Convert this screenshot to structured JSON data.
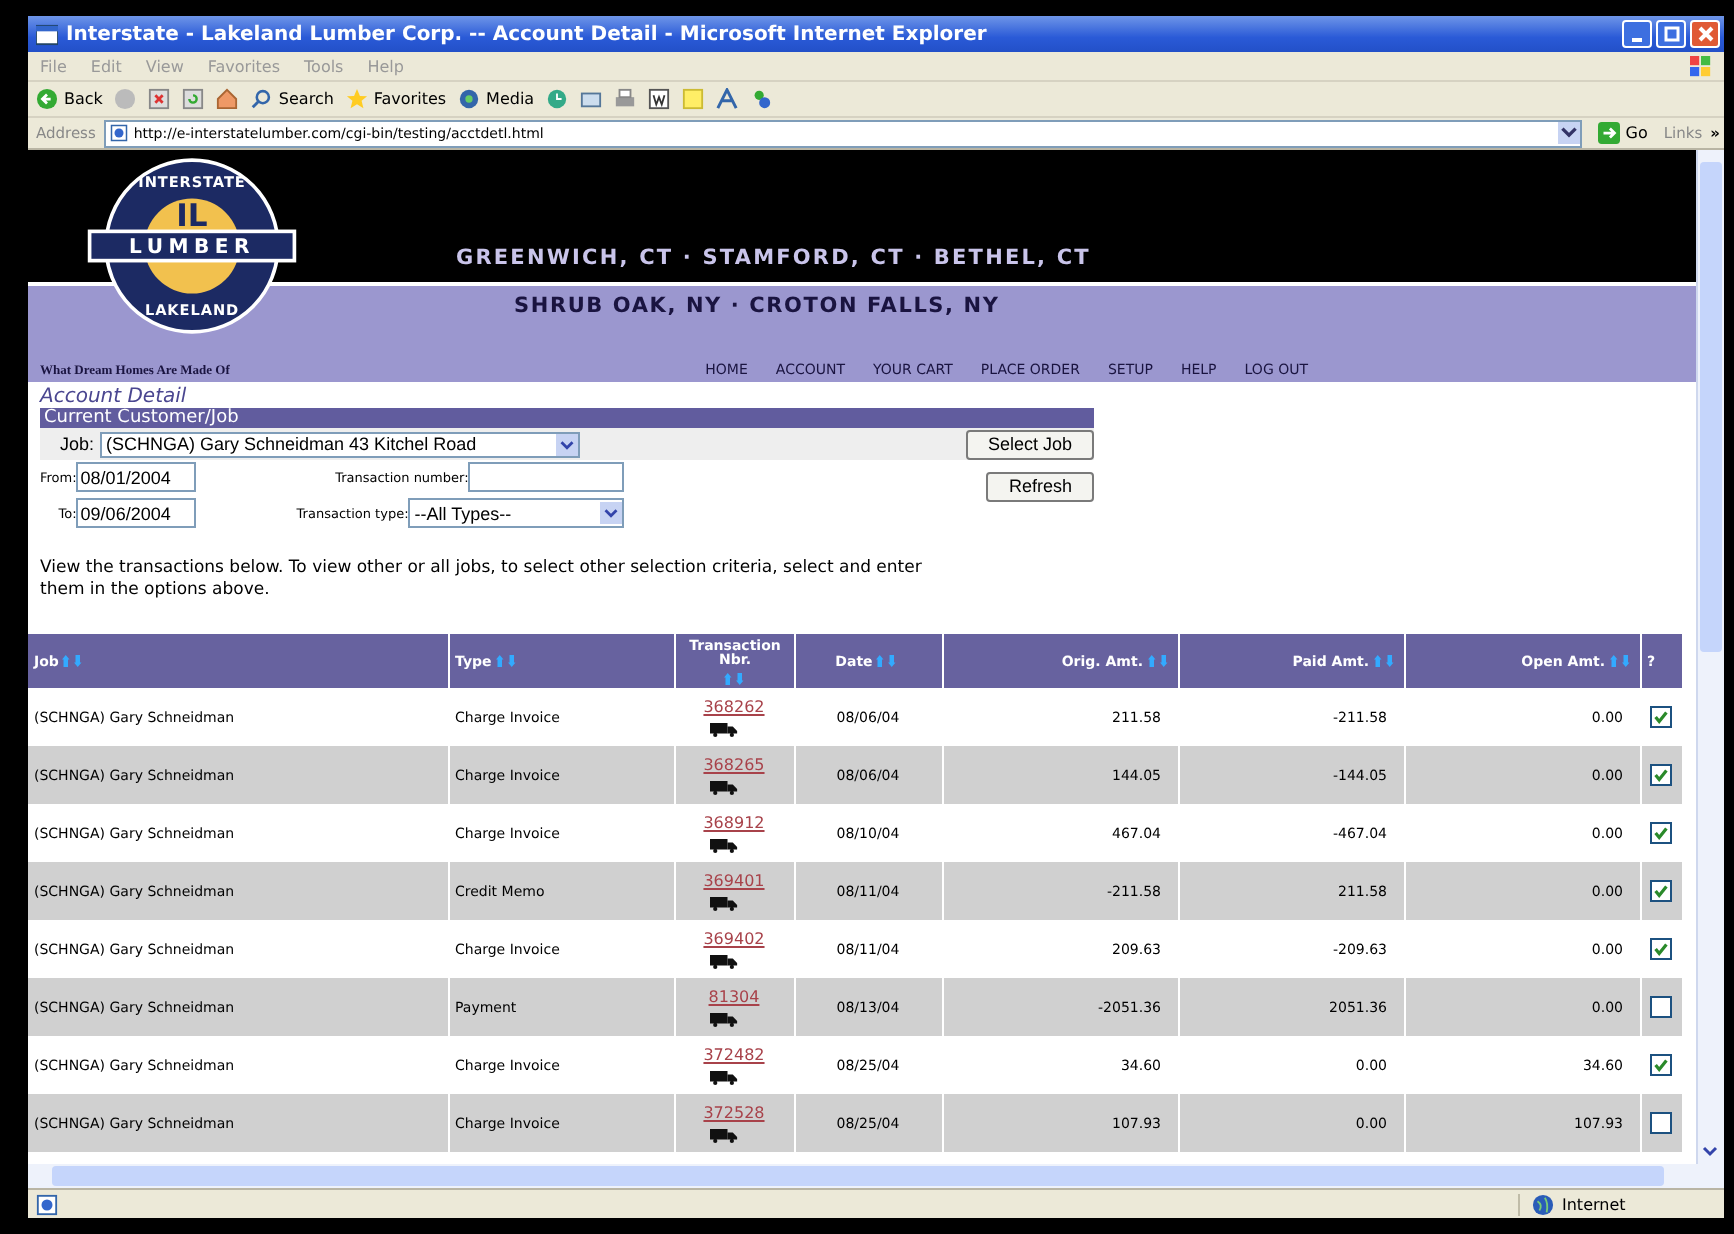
{
  "window": {
    "title": "Interstate - Lakeland Lumber Corp. -- Account Detail - Microsoft Internet Explorer"
  },
  "menu": [
    "File",
    "Edit",
    "View",
    "Favorites",
    "Tools",
    "Help"
  ],
  "toolbar": {
    "back": "Back",
    "search": "Search",
    "favorites": "Favorites",
    "media": "Media"
  },
  "address": {
    "label": "Address",
    "url": "http://e-interstatelumber.com/cgi-bin/testing/acctdetl.html",
    "go": "Go",
    "links": "Links",
    "more": "»"
  },
  "site": {
    "logo": {
      "top": "INTERSTATE",
      "center": "IL",
      "band": "LUMBER",
      "bottom": "LAKELAND"
    },
    "locations_1": "GREENWICH, CT · STAMFORD, CT · BETHEL, CT",
    "locations_2": "SHRUB OAK, NY · CROTON FALLS, NY",
    "tagline": "What Dream Homes Are Made Of",
    "nav": [
      "HOME",
      "ACCOUNT",
      "YOUR CART",
      "PLACE ORDER",
      "SETUP",
      "HELP",
      "LOG OUT"
    ]
  },
  "page_title": "Account Detail",
  "section_title": "Current Customer/Job",
  "form": {
    "job_label": "Job:",
    "job_value": "(SCHNGA) Gary Schneidman 43 Kitchel Road",
    "select_job": "Select Job",
    "from_label": "From:",
    "from_value": "08/01/2004",
    "to_label": "To:",
    "to_value": "09/06/2004",
    "txn_number_label": "Transaction number:",
    "txn_type_label": "Transaction type:",
    "txn_type_value": "--All Types--",
    "refresh": "Refresh"
  },
  "instructions": "View the transactions below. To view other or all jobs, to select other selection criteria, select and enter them in the options above.",
  "table": {
    "columns": [
      "Job",
      "Type",
      "Transaction Nbr.",
      "Date",
      "Orig. Amt.",
      "Paid Amt.",
      "Open Amt.",
      "?"
    ],
    "rows": [
      {
        "job": "(SCHNGA) Gary Schneidman",
        "type": "Charge Invoice",
        "nbr": "368262",
        "date": "08/06/04",
        "orig": "211.58",
        "paid": "-211.58",
        "open": "0.00",
        "checked": true
      },
      {
        "job": "(SCHNGA) Gary Schneidman",
        "type": "Charge Invoice",
        "nbr": "368265",
        "date": "08/06/04",
        "orig": "144.05",
        "paid": "-144.05",
        "open": "0.00",
        "checked": true
      },
      {
        "job": "(SCHNGA) Gary Schneidman",
        "type": "Charge Invoice",
        "nbr": "368912",
        "date": "08/10/04",
        "orig": "467.04",
        "paid": "-467.04",
        "open": "0.00",
        "checked": true
      },
      {
        "job": "(SCHNGA) Gary Schneidman",
        "type": "Credit Memo",
        "nbr": "369401",
        "date": "08/11/04",
        "orig": "-211.58",
        "paid": "211.58",
        "open": "0.00",
        "checked": true
      },
      {
        "job": "(SCHNGA) Gary Schneidman",
        "type": "Charge Invoice",
        "nbr": "369402",
        "date": "08/11/04",
        "orig": "209.63",
        "paid": "-209.63",
        "open": "0.00",
        "checked": true
      },
      {
        "job": "(SCHNGA) Gary Schneidman",
        "type": "Payment",
        "nbr": "81304",
        "date": "08/13/04",
        "orig": "-2051.36",
        "paid": "2051.36",
        "open": "0.00",
        "checked": false
      },
      {
        "job": "(SCHNGA) Gary Schneidman",
        "type": "Charge Invoice",
        "nbr": "372482",
        "date": "08/25/04",
        "orig": "34.60",
        "paid": "0.00",
        "open": "34.60",
        "checked": true
      },
      {
        "job": "(SCHNGA) Gary Schneidman",
        "type": "Charge Invoice",
        "nbr": "372528",
        "date": "08/25/04",
        "orig": "107.93",
        "paid": "0.00",
        "open": "107.93",
        "checked": false
      }
    ]
  },
  "status_bar": {
    "zone": "Internet"
  }
}
